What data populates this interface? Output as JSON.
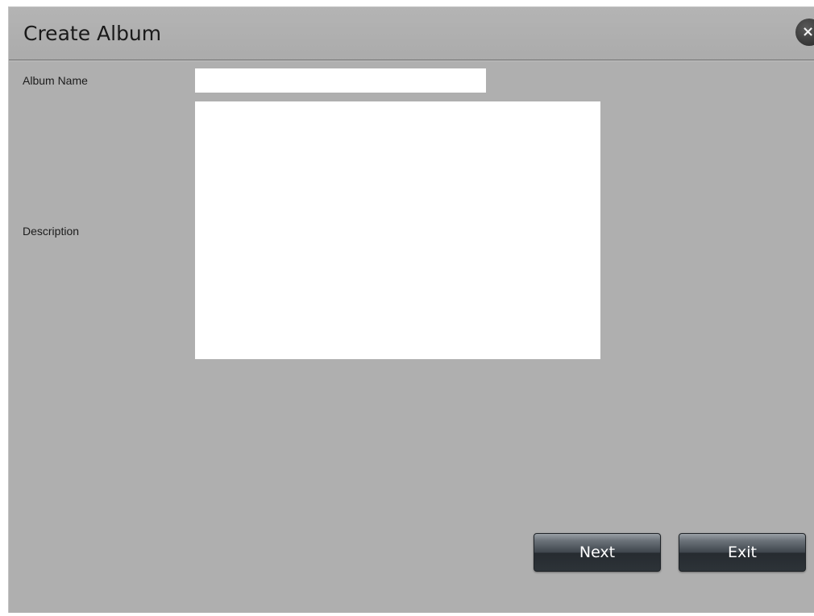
{
  "dialog": {
    "title": "Create Album",
    "close_glyph": "×"
  },
  "form": {
    "album_name_label": "Album Name",
    "album_name_value": "",
    "description_label": "Description",
    "description_value": ""
  },
  "buttons": {
    "next_label": "Next",
    "exit_label": "Exit"
  },
  "icons": {
    "close": "close-icon"
  },
  "colors": {
    "dialog_background": "#afafaf",
    "button_dark": "#2d3338",
    "field_background": "#ffffff"
  }
}
